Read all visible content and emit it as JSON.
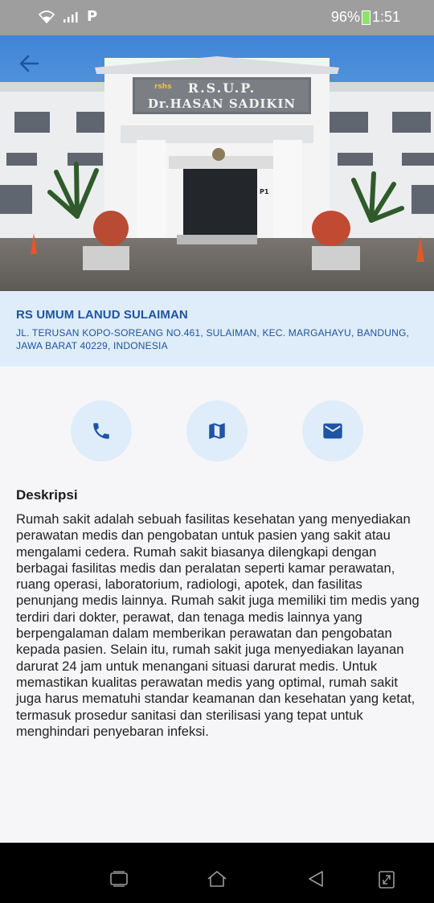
{
  "status_bar": {
    "battery": "96%",
    "time": "1:51",
    "icons": [
      "wifi-icon",
      "signal-icon",
      "p-app-icon",
      "battery-charging-icon"
    ],
    "p_label": "P"
  },
  "hero": {
    "sign_line1": "R.S.U.P.",
    "sign_line2": "Dr.HASAN SADIKIN",
    "sign_badge": "rshs",
    "pillar_label": "P1"
  },
  "hospital": {
    "name": "RS UMUM LANUD SULAIMAN",
    "address": "JL. TERUSAN KOPO-SOREANG NO.461, SULAIMAN, KEC. MARGAHAYU, BANDUNG, JAWA BARAT 40229, INDONESIA"
  },
  "actions": [
    {
      "name": "call",
      "icon": "phone-icon"
    },
    {
      "name": "map",
      "icon": "map-icon"
    },
    {
      "name": "email",
      "icon": "mail-icon"
    }
  ],
  "description": {
    "title": "Deskripsi",
    "body": "Rumah sakit adalah sebuah fasilitas kesehatan yang menyediakan perawatan medis dan pengobatan untuk pasien yang sakit atau mengalami cedera. Rumah sakit biasanya dilengkapi dengan berbagai fasilitas medis dan peralatan seperti kamar perawatan, ruang operasi, laboratorium, radiologi, apotek, dan fasilitas penunjang medis lainnya. Rumah sakit juga memiliki tim medis yang terdiri dari dokter, perawat, dan tenaga medis lainnya yang berpengalaman dalam memberikan perawatan dan pengobatan kepada pasien. Selain itu, rumah sakit juga menyediakan layanan darurat 24 jam untuk menangani situasi darurat medis. Untuk memastikan kualitas perawatan medis yang optimal, rumah sakit juga harus mematuhi standar keamanan dan kesehatan yang ketat, termasuk prosedur sanitasi dan sterilisasi yang tepat untuk menghindari penyebaran infeksi."
  },
  "colors": {
    "accent": "#1f53a3",
    "card_bg": "#deedf9",
    "status_bar": "#9e9e9e"
  }
}
